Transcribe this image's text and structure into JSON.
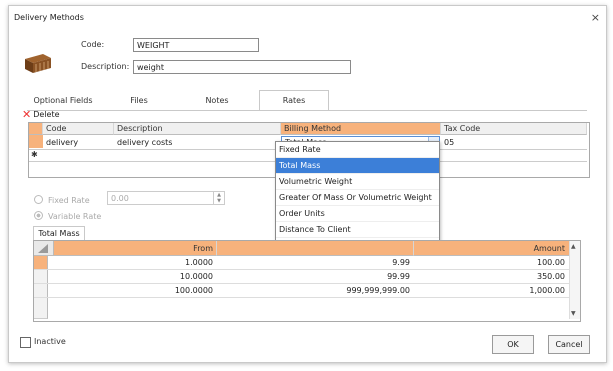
{
  "window": {
    "title": "Delivery Methods",
    "close_glyph": "×"
  },
  "header": {
    "code_label": "Code:",
    "code_value": "WEIGHT",
    "description_label": "Description:",
    "description_value": "weight"
  },
  "tabs": [
    {
      "label": "Optional Fields"
    },
    {
      "label": "Files"
    },
    {
      "label": "Notes"
    },
    {
      "label": "Rates"
    }
  ],
  "toolbar": {
    "delete_label": "Delete",
    "delete_icon": "✕"
  },
  "rates_grid": {
    "columns": [
      "Code",
      "Description",
      "Billing Method",
      "Tax Code"
    ],
    "row": {
      "code": "delivery",
      "description": "delivery costs",
      "billing_method": "Total Mass",
      "tax_code": "05"
    },
    "new_row_marker": "✱"
  },
  "billing_dropdown": {
    "options": [
      "Fixed Rate",
      "Total Mass",
      "Volumetric Weight",
      "Greater Of Mass Or Volumetric Weight",
      "Order Units",
      "Distance To Client"
    ],
    "selected": "Total Mass",
    "arrow": "⌄"
  },
  "rate_type": {
    "fixed_label": "Fixed Rate",
    "fixed_value": "0.00",
    "variable_label": "Variable Rate"
  },
  "subtab": {
    "label": "Total Mass"
  },
  "mass_grid": {
    "columns": {
      "from": "From",
      "amount": "Amount"
    },
    "rows": [
      {
        "from": "1.0000",
        "to": "9.99",
        "amount": "100.00"
      },
      {
        "from": "10.0000",
        "to": "99.99",
        "amount": "350.00"
      },
      {
        "from": "100.0000",
        "to": "999,999,999.00",
        "amount": "1,000.00"
      }
    ]
  },
  "footer": {
    "inactive_label": "Inactive",
    "ok_label": "OK",
    "cancel_label": "Cancel"
  },
  "colors": {
    "header_accent": "#f7b27c",
    "selected_option": "#3c7fd8",
    "delete_icon": "#e33333"
  }
}
